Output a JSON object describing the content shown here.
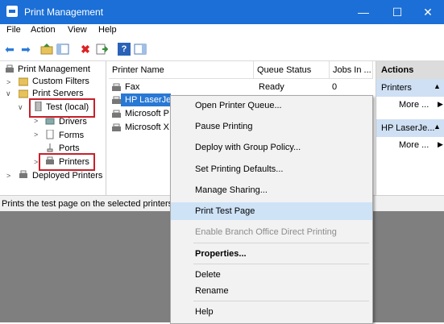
{
  "window": {
    "title": "Print Management",
    "minimize": "—",
    "maximize": "☐",
    "close": "✕"
  },
  "menu": [
    "File",
    "Action",
    "View",
    "Help"
  ],
  "tree": {
    "root": "Print Management",
    "custom_filters": "Custom Filters",
    "print_servers": "Print Servers",
    "server": "Test (local)",
    "drivers": "Drivers",
    "forms": "Forms",
    "ports": "Ports",
    "printers": "Printers",
    "deployed": "Deployed Printers"
  },
  "list": {
    "headers": {
      "name": "Printer Name",
      "status": "Queue Status",
      "jobs": "Jobs In ..."
    },
    "rows": [
      {
        "name": "Fax",
        "status": "Ready",
        "jobs": "0"
      },
      {
        "name": "HP LaserJet",
        "status": "",
        "jobs": ""
      },
      {
        "name": "Microsoft P",
        "status": "",
        "jobs": ""
      },
      {
        "name": "Microsoft X",
        "status": "",
        "jobs": ""
      }
    ]
  },
  "actions": {
    "title": "Actions",
    "sections": [
      {
        "label": "Printers",
        "more": "More ..."
      },
      {
        "label": "HP LaserJe...",
        "more": "More ..."
      }
    ]
  },
  "status_text": "Prints the test page on the selected printers.",
  "context_menu": {
    "open_queue": "Open Printer Queue...",
    "pause": "Pause Printing",
    "deploy": "Deploy with Group Policy...",
    "defaults": "Set Printing Defaults...",
    "sharing": "Manage Sharing...",
    "test_page": "Print Test Page",
    "branch": "Enable Branch Office Direct Printing",
    "properties": "Properties...",
    "delete": "Delete",
    "rename": "Rename",
    "help": "Help"
  },
  "colors": {
    "titlebar": "#1b6fd6",
    "selection": "#cfe3f7",
    "highlight_box": "#c8202a"
  }
}
